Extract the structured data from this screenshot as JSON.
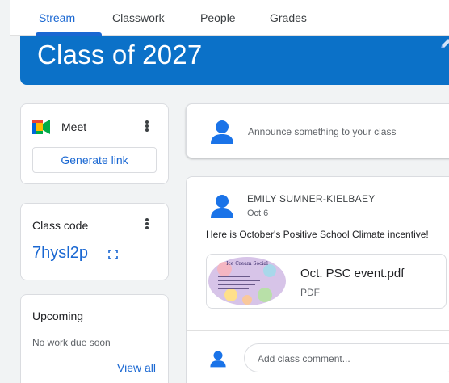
{
  "tabs": [
    {
      "label": "Stream",
      "active": true
    },
    {
      "label": "Classwork"
    },
    {
      "label": "People"
    },
    {
      "label": "Grades"
    }
  ],
  "banner": {
    "title": "Class of 2027"
  },
  "meet": {
    "label": "Meet",
    "button": "Generate link"
  },
  "class_code": {
    "label": "Class code",
    "value": "7hysl2p"
  },
  "upcoming": {
    "title": "Upcoming",
    "empty": "No work due soon",
    "link": "View all"
  },
  "announce": {
    "placeholder": "Announce something to your class"
  },
  "post": {
    "author": "EMILY SUMNER-KIELBAEY",
    "date": "Oct 6",
    "text": "Here is October's Positive School Climate incentive!",
    "attachment": {
      "name": "Oct. PSC event.pdf",
      "type": "PDF",
      "thumb_title": "Ice Cream Social"
    },
    "comment_placeholder": "Add class comment..."
  },
  "colors": {
    "accent": "#1967d2",
    "banner": "#0b71c8",
    "avatar": "#1a73e8"
  }
}
